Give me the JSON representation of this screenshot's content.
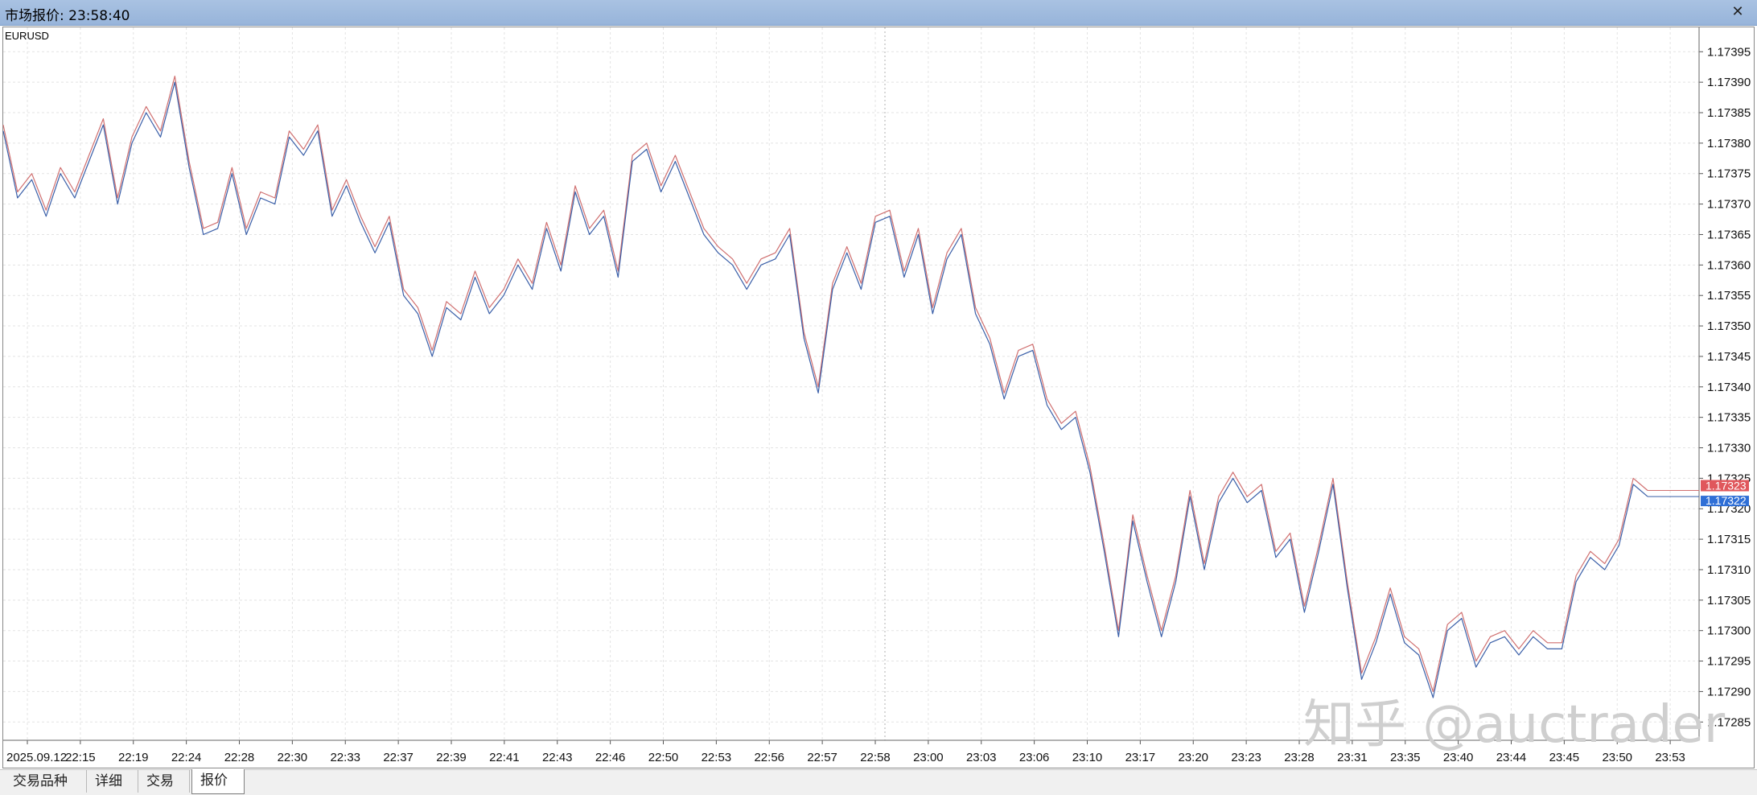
{
  "window": {
    "title": "市场报价: 23:58:40",
    "close_glyph": "✕"
  },
  "tabs": [
    {
      "label": "交易品种",
      "active": false
    },
    {
      "label": "详细",
      "active": false
    },
    {
      "label": "交易",
      "active": false
    },
    {
      "label": "报价",
      "active": true
    }
  ],
  "watermark": "知乎 @auctrader",
  "chart_data": {
    "type": "line",
    "symbol": "EURUSD",
    "title": "EURUSD",
    "ylim": [
      1.17282,
      1.17399
    ],
    "yticks": [
      1.17285,
      1.1729,
      1.17295,
      1.173,
      1.17305,
      1.1731,
      1.17315,
      1.1732,
      1.17325,
      1.1733,
      1.17335,
      1.1734,
      1.17345,
      1.1735,
      1.17355,
      1.1736,
      1.17365,
      1.1737,
      1.17375,
      1.1738,
      1.17385,
      1.1739,
      1.17395
    ],
    "ytick_labels": [
      "1.17285",
      "1.17290",
      "1.17295",
      "1.17300",
      "1.17305",
      "1.17310",
      "1.17315",
      "1.17320",
      "1.17325",
      "1.17330",
      "1.17335",
      "1.17340",
      "1.17345",
      "1.17350",
      "1.17355",
      "1.17360",
      "1.17365",
      "1.17370",
      "1.17375",
      "1.17380",
      "1.17385",
      "1.17390",
      "1.17395"
    ],
    "xtick_labels": [
      "2025.09.12",
      "22:15",
      "22:19",
      "22:24",
      "22:28",
      "22:30",
      "22:33",
      "22:37",
      "22:39",
      "22:41",
      "22:43",
      "22:46",
      "22:50",
      "22:53",
      "22:56",
      "22:57",
      "22:58",
      "23:00",
      "23:03",
      "23:06",
      "23:10",
      "23:17",
      "23:20",
      "23:23",
      "23:28",
      "23:31",
      "23:35",
      "23:40",
      "23:44",
      "23:45",
      "23:50",
      "23:53"
    ],
    "grid": true,
    "current_ask": 1.17323,
    "current_bid": 1.17322,
    "ask_label": "1.17323",
    "bid_label": "1.17322",
    "series": [
      {
        "name": "Ask",
        "color": "#d07070",
        "values": [
          1.17383,
          1.17372,
          1.17375,
          1.17369,
          1.17376,
          1.17372,
          1.17378,
          1.17384,
          1.17371,
          1.17381,
          1.17386,
          1.17382,
          1.17391,
          1.17377,
          1.17366,
          1.17367,
          1.17376,
          1.17366,
          1.17372,
          1.17371,
          1.17382,
          1.17379,
          1.17383,
          1.17369,
          1.17374,
          1.17368,
          1.17363,
          1.17368,
          1.17356,
          1.17353,
          1.17346,
          1.17354,
          1.17352,
          1.17359,
          1.17353,
          1.17356,
          1.17361,
          1.17357,
          1.17367,
          1.1736,
          1.17373,
          1.17366,
          1.17369,
          1.17359,
          1.17378,
          1.1738,
          1.17373,
          1.17378,
          1.17372,
          1.17366,
          1.17363,
          1.17361,
          1.17357,
          1.17361,
          1.17362,
          1.17366,
          1.17349,
          1.1734,
          1.17357,
          1.17363,
          1.17357,
          1.17368,
          1.17369,
          1.17359,
          1.17366,
          1.17353,
          1.17362,
          1.17366,
          1.17353,
          1.17348,
          1.17339,
          1.17346,
          1.17347,
          1.17338,
          1.17334,
          1.17336,
          1.17327,
          1.17314,
          1.173,
          1.17319,
          1.17309,
          1.173,
          1.17309,
          1.17323,
          1.17311,
          1.17322,
          1.17326,
          1.17322,
          1.17324,
          1.17313,
          1.17316,
          1.17304,
          1.17314,
          1.17325,
          1.17308,
          1.17293,
          1.17299,
          1.17307,
          1.17299,
          1.17297,
          1.1729,
          1.17301,
          1.17303,
          1.17295,
          1.17299,
          1.173,
          1.17297,
          1.173,
          1.17298,
          1.17298,
          1.17309,
          1.17313,
          1.17311,
          1.17315,
          1.17325,
          1.17323
        ]
      },
      {
        "name": "Bid",
        "color": "#3a5fa8",
        "values": [
          1.17382,
          1.17371,
          1.17374,
          1.17368,
          1.17375,
          1.17371,
          1.17377,
          1.17383,
          1.1737,
          1.1738,
          1.17385,
          1.17381,
          1.1739,
          1.17376,
          1.17365,
          1.17366,
          1.17375,
          1.17365,
          1.17371,
          1.1737,
          1.17381,
          1.17378,
          1.17382,
          1.17368,
          1.17373,
          1.17367,
          1.17362,
          1.17367,
          1.17355,
          1.17352,
          1.17345,
          1.17353,
          1.17351,
          1.17358,
          1.17352,
          1.17355,
          1.1736,
          1.17356,
          1.17366,
          1.17359,
          1.17372,
          1.17365,
          1.17368,
          1.17358,
          1.17377,
          1.17379,
          1.17372,
          1.17377,
          1.17371,
          1.17365,
          1.17362,
          1.1736,
          1.17356,
          1.1736,
          1.17361,
          1.17365,
          1.17348,
          1.17339,
          1.17356,
          1.17362,
          1.17356,
          1.17367,
          1.17368,
          1.17358,
          1.17365,
          1.17352,
          1.17361,
          1.17365,
          1.17352,
          1.17347,
          1.17338,
          1.17345,
          1.17346,
          1.17337,
          1.17333,
          1.17335,
          1.17326,
          1.17313,
          1.17299,
          1.17318,
          1.17308,
          1.17299,
          1.17308,
          1.17322,
          1.1731,
          1.17321,
          1.17325,
          1.17321,
          1.17323,
          1.17312,
          1.17315,
          1.17303,
          1.17313,
          1.17324,
          1.17307,
          1.17292,
          1.17298,
          1.17306,
          1.17298,
          1.17296,
          1.17289,
          1.173,
          1.17302,
          1.17294,
          1.17298,
          1.17299,
          1.17296,
          1.17299,
          1.17297,
          1.17297,
          1.17308,
          1.17312,
          1.1731,
          1.17314,
          1.17324,
          1.17322
        ]
      }
    ]
  }
}
